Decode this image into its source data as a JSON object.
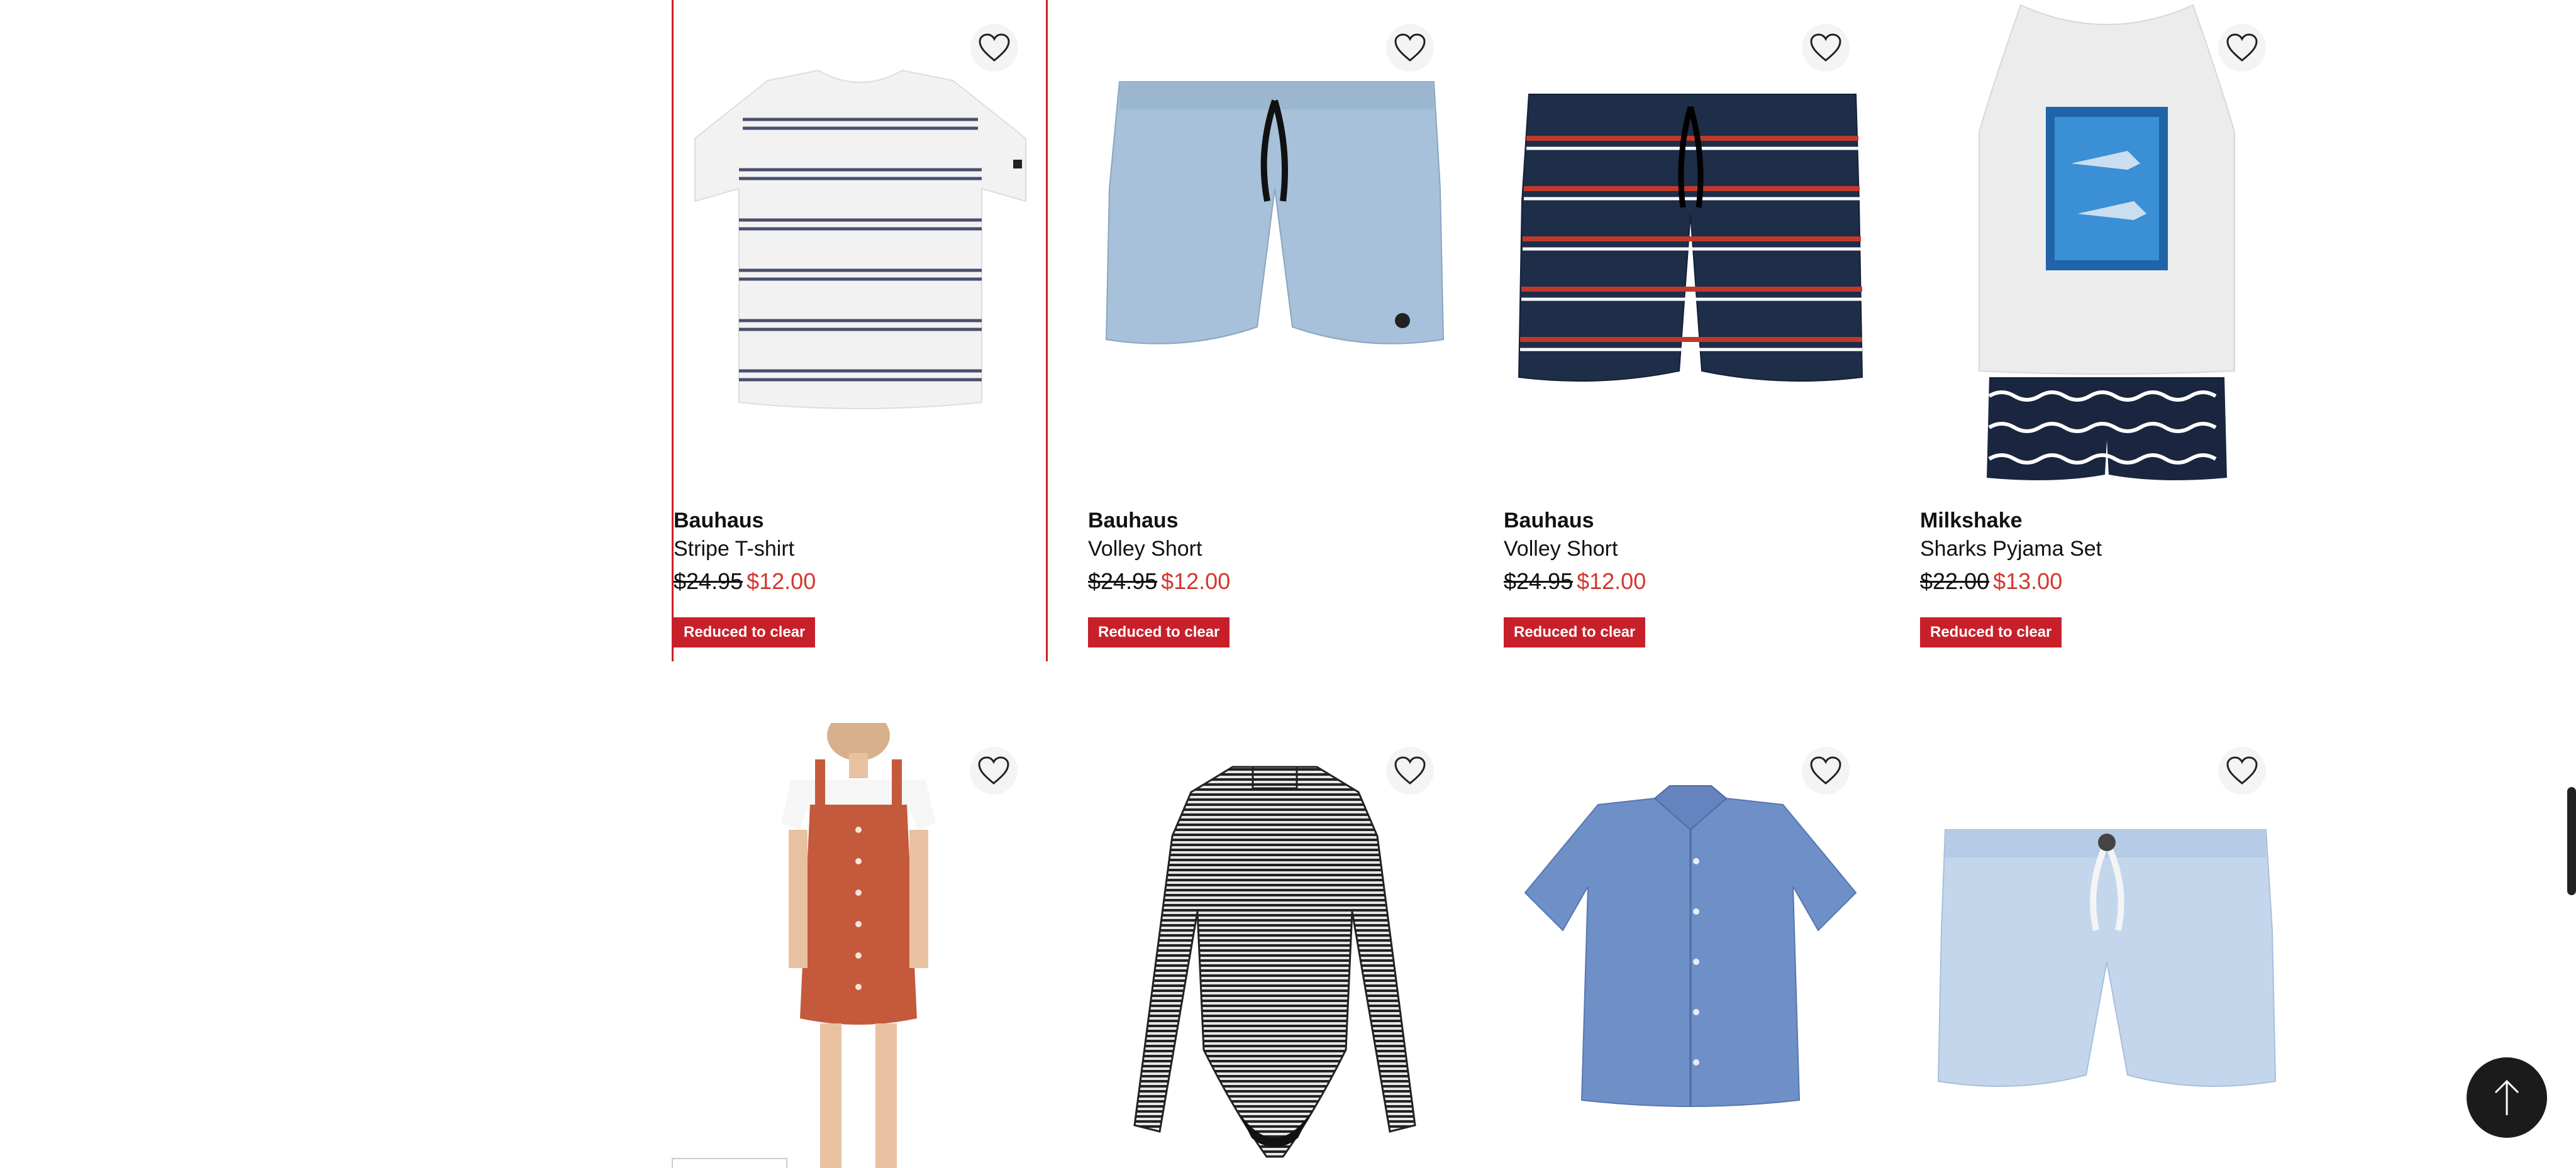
{
  "products": [
    {
      "brand": "Bauhaus",
      "name": "Stripe T-shirt",
      "was_price": "$24.95",
      "now_price": "$12.00",
      "badge": "Reduced to clear",
      "image": "striped-tshirt"
    },
    {
      "brand": "Bauhaus",
      "name": "Volley Short",
      "was_price": "$24.95",
      "now_price": "$12.00",
      "badge": "Reduced to clear",
      "image": "light-blue-volley-short"
    },
    {
      "brand": "Bauhaus",
      "name": "Volley Short",
      "was_price": "$24.95",
      "now_price": "$12.00",
      "badge": "Reduced to clear",
      "image": "navy-stripe-volley-short"
    },
    {
      "brand": "Milkshake",
      "name": "Sharks Pyjama Set",
      "was_price": "$22.00",
      "now_price": "$13.00",
      "badge": "Reduced to clear",
      "image": "sharks-pyjama-set"
    },
    {
      "image": "corduroy-pinafore-dress"
    },
    {
      "image": "striped-long-sleeve-swimsuit"
    },
    {
      "image": "chambray-shirt"
    },
    {
      "image": "light-blue-shorts"
    }
  ],
  "icons": {
    "wishlist": "heart-outline-icon",
    "back_to_top": "arrow-up-icon"
  },
  "colors": {
    "sale_red": "#c8202a",
    "price_red": "#d4372c",
    "button_dark": "#1b1b1b"
  }
}
